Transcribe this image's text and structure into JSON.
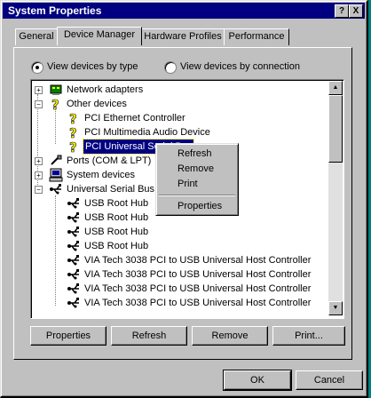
{
  "window": {
    "title": "System Properties",
    "help_btn": "?",
    "close_btn": "X"
  },
  "tabs": [
    {
      "label": "General",
      "active": false
    },
    {
      "label": "Device Manager",
      "active": true
    },
    {
      "label": "Hardware Profiles",
      "active": false
    },
    {
      "label": "Performance",
      "active": false
    }
  ],
  "view_options": {
    "by_type": {
      "label": "View devices by type",
      "selected": true
    },
    "by_connection": {
      "label": "View devices by connection",
      "selected": false
    }
  },
  "tree": {
    "items": [
      {
        "label": "Network adapters",
        "level": 0,
        "icon": "network-adapter-icon",
        "expander": "+"
      },
      {
        "label": "Other devices",
        "level": 0,
        "icon": "question-mark-icon",
        "expander": "−"
      },
      {
        "label": "PCI Ethernet Controller",
        "level": 1,
        "icon": "unknown-device-icon"
      },
      {
        "label": "PCI Multimedia Audio Device",
        "level": 1,
        "icon": "unknown-device-icon"
      },
      {
        "label": "PCI Universal Serial Bus",
        "level": 1,
        "icon": "unknown-device-icon",
        "selected": true
      },
      {
        "label": "Ports (COM & LPT)",
        "level": 0,
        "icon": "port-icon",
        "expander": "+"
      },
      {
        "label": "System devices",
        "level": 0,
        "icon": "computer-icon",
        "expander": "+"
      },
      {
        "label": "Universal Serial Bus",
        "level": 0,
        "icon": "usb-icon",
        "expander": "−"
      },
      {
        "label": "USB Root Hub",
        "level": 1,
        "icon": "usb-icon"
      },
      {
        "label": "USB Root Hub",
        "level": 1,
        "icon": "usb-icon"
      },
      {
        "label": "USB Root Hub",
        "level": 1,
        "icon": "usb-icon"
      },
      {
        "label": "USB Root Hub",
        "level": 1,
        "icon": "usb-icon"
      },
      {
        "label": "VIA Tech 3038 PCI to USB Universal Host Controller",
        "level": 1,
        "icon": "usb-icon"
      },
      {
        "label": "VIA Tech 3038 PCI to USB Universal Host Controller",
        "level": 1,
        "icon": "usb-icon"
      },
      {
        "label": "VIA Tech 3038 PCI to USB Universal Host Controller",
        "level": 1,
        "icon": "usb-icon"
      },
      {
        "label": "VIA Tech 3038 PCI to USB Universal Host Controller",
        "level": 1,
        "icon": "usb-icon"
      }
    ]
  },
  "context_menu": {
    "items": [
      "Refresh",
      "Remove",
      "Print"
    ],
    "last": "Properties"
  },
  "panel_buttons": {
    "properties": "Properties",
    "refresh": "Refresh",
    "remove": "Remove",
    "print": "Print..."
  },
  "dialog_buttons": {
    "ok": "OK",
    "cancel": "Cancel"
  },
  "colors": {
    "title_bar": "#000080",
    "selection": "#000080",
    "face": "#c0c0c0",
    "desktop": "#008080"
  }
}
